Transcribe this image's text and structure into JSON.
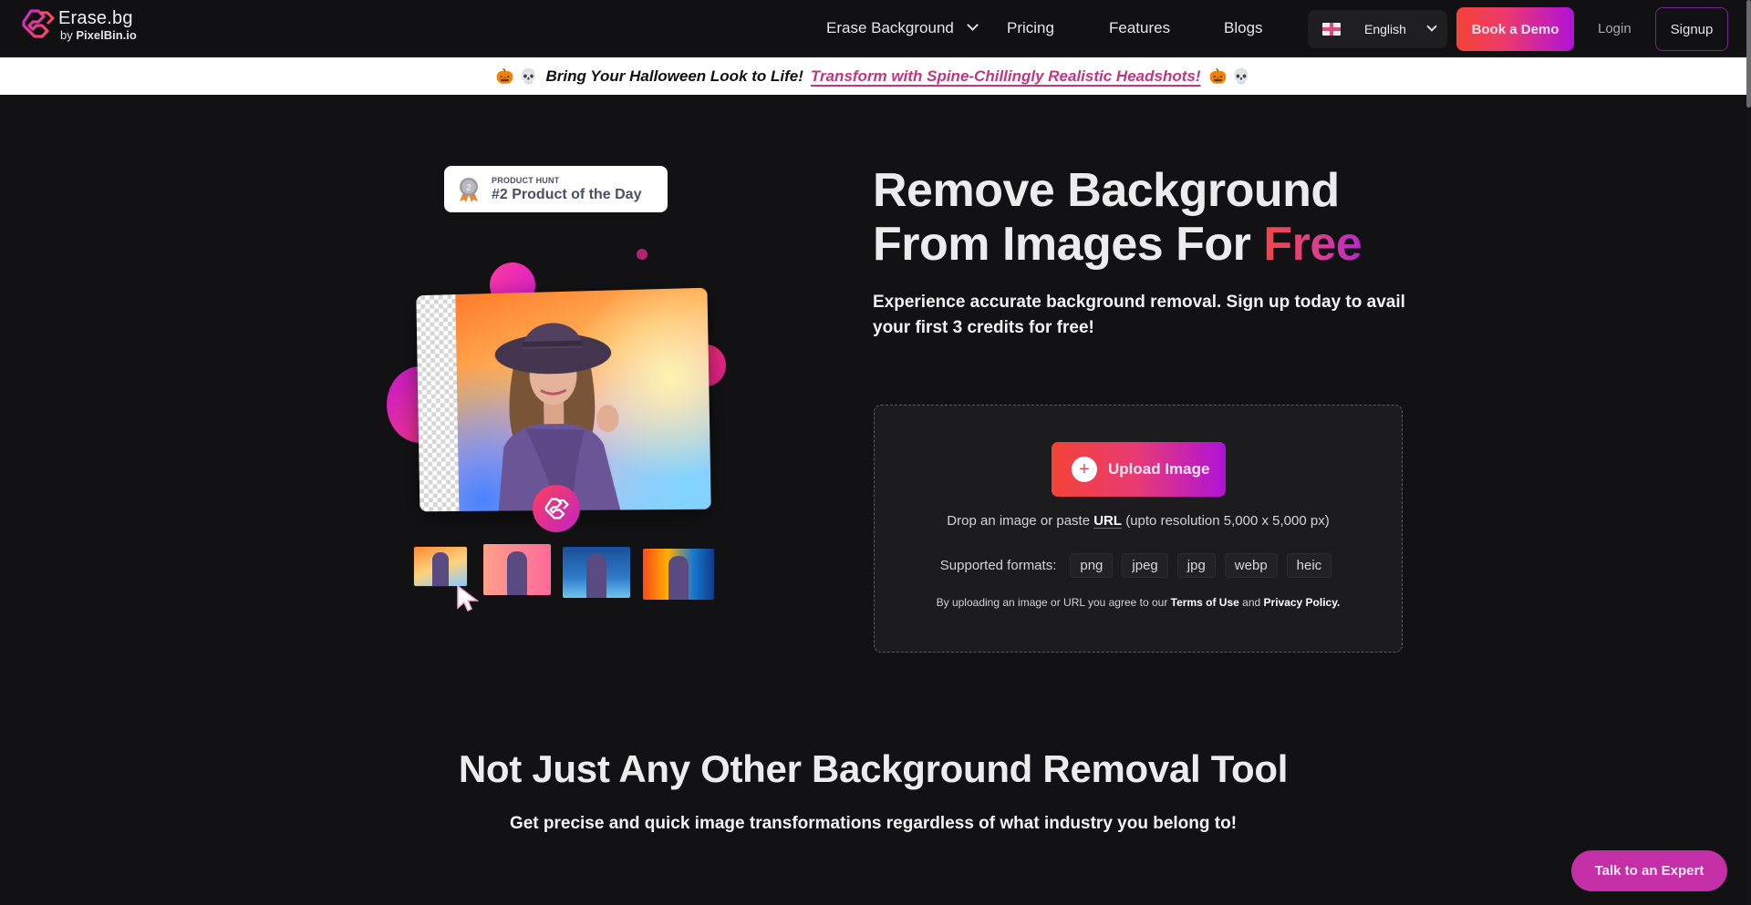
{
  "nav": {
    "logo_title": "Erase.bg",
    "logo_by": "by",
    "logo_brand": "PixelBin.io",
    "links": [
      {
        "label": "Erase Background",
        "has_dropdown": true
      },
      {
        "label": "Pricing"
      },
      {
        "label": "Features"
      },
      {
        "label": "Blogs"
      }
    ],
    "language": {
      "flag_icon": "uk-flag-icon",
      "selected": "English"
    },
    "book_demo": "Book a Demo",
    "login": "Login",
    "signup": "Signup"
  },
  "banner": {
    "emoji_left": [
      "🎃",
      "💀"
    ],
    "text": "Bring Your Halloween Look to Life!",
    "link": "Transform with Spine-Chillingly Realistic Headshots!",
    "emoji_right": [
      "🎃",
      "💀"
    ]
  },
  "product_hunt": {
    "label": "PRODUCT HUNT",
    "rank_text": "#2 Product of the Day",
    "medal_number": "2"
  },
  "hero": {
    "title_line1": "Remove Background",
    "title_line2_prefix": "From Images For ",
    "title_highlight": "Free",
    "subtitle": "Experience accurate background removal. Sign up today to avail your first 3 credits for free!"
  },
  "upload": {
    "button_label": "Upload Image",
    "drop_prefix": "Drop an image or paste ",
    "drop_url": "URL",
    "drop_suffix": " (upto resolution 5,000 x 5,000 px)",
    "formats_label": "Supported formats:",
    "formats": [
      "png",
      "jpeg",
      "jpg",
      "webp",
      "heic"
    ],
    "legal_prefix": "By uploading an image or URL you agree to our ",
    "terms": "Terms of Use",
    "legal_and": " and ",
    "privacy": "Privacy Policy."
  },
  "section2": {
    "title": "Not Just Any Other Background Removal Tool",
    "subtitle": "Get precise and quick image transformations regardless of what industry you belong to!"
  },
  "floating": {
    "talk_expert": "Talk to an Expert"
  },
  "colors": {
    "background": "#121214",
    "accent_start": "#f44336",
    "accent_end": "#b012d9",
    "banner_link": "#c2367f",
    "expert_button": "#c42fa8"
  }
}
